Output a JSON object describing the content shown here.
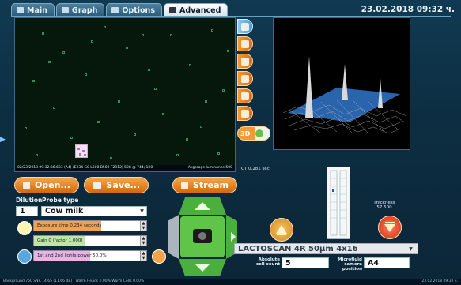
{
  "tabs": [
    {
      "label": "Main",
      "icon": "main-icon"
    },
    {
      "label": "Graph",
      "icon": "graph-icon"
    },
    {
      "label": "Options",
      "icon": "options-icon"
    },
    {
      "label": "Advanced",
      "icon": "advanced-icon",
      "active": true
    }
  ],
  "datetime": "23.02.2018 09:32 ч.",
  "camera": {
    "stats_left": "02/23/2018 09:32:36.633 (A4) (E234 G0 L500 B500 F2912) 528 @ 744; 120",
    "stats_right": "Avgerage luminance 500",
    "ct_label": "CT 0.281 sec"
  },
  "toggle_3d": {
    "label": "3D"
  },
  "buttons": {
    "open": "Open...",
    "save": "Save...",
    "stream": "Stream"
  },
  "dilution": {
    "label": "Dilution",
    "value": "1"
  },
  "probe_type": {
    "label": "Probe type",
    "value": "Cow milk"
  },
  "sliders": {
    "exposure": {
      "text": "Exposure time 0.234 seconds"
    },
    "gain": {
      "text": "Gain 0 (factor 1.000)"
    },
    "lights": {
      "text": "1st and 2nd lights power 50.0%"
    }
  },
  "thickness": {
    "label": "Thickness",
    "value": "57.500"
  },
  "device": {
    "value": "LACTOSCAN 4R 50µm 4x16"
  },
  "absolute_cell_count": {
    "label": "Absolute cell count",
    "value": "5"
  },
  "microfluid_position": {
    "label": "Microfluid camera position",
    "value": "A4"
  },
  "footer": {
    "left": "Background 760  SNR 14.65 (11.66 dB)  |  Warm Heads 0.00%  Warm Cells 0.00%",
    "right": "23.02.2018 09:32 ч."
  },
  "colors": {
    "accent_orange": "#e9821f",
    "accent_green": "#5cc04a",
    "bg": "#0c2a3c"
  }
}
